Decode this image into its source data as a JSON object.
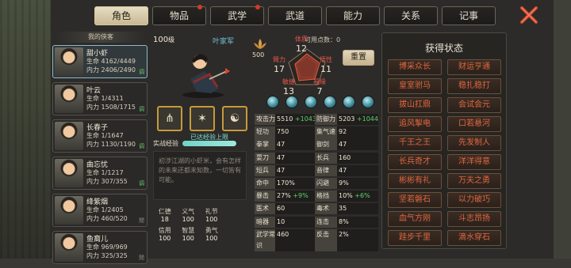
{
  "tabs": [
    {
      "label": "角色",
      "active": true,
      "dot": false
    },
    {
      "label": "物品",
      "active": false,
      "dot": true
    },
    {
      "label": "武学",
      "active": false,
      "dot": true
    },
    {
      "label": "武道",
      "active": false,
      "dot": false
    },
    {
      "label": "能力",
      "active": false,
      "dot": false
    },
    {
      "label": "关系",
      "active": false,
      "dot": false
    },
    {
      "label": "记事",
      "active": false,
      "dot": false
    }
  ],
  "roster": {
    "title": "我的侠客",
    "heroes": [
      {
        "name": "甜小虾",
        "hp": "生命 4162/4449",
        "mp": "内力 2406/2490",
        "tag": "调",
        "selected": true
      },
      {
        "name": "叶云",
        "hp": "生命 1/4311",
        "mp": "内力 1508/1715",
        "tag": "调",
        "selected": false
      },
      {
        "name": "长春子",
        "hp": "生命 1/1647",
        "mp": "内力 1130/1190",
        "tag": "调",
        "selected": false
      },
      {
        "name": "曲忘忧",
        "hp": "生命 1/1217",
        "mp": "内力 307/355",
        "tag": "调",
        "selected": false
      },
      {
        "name": "绛紫烟",
        "hp": "生命 1/2405",
        "mp": "内力 460/520",
        "tag": "閒",
        "selected": false
      },
      {
        "name": "鱼裔儿",
        "hp": "生命 969/969",
        "mp": "内力 325/325",
        "tag": "閒",
        "selected": false
      }
    ]
  },
  "character": {
    "level": "100",
    "level_unit": "级",
    "faction": "叶家军",
    "exp_label": "实战经验",
    "exp_text": "已达经验上限",
    "exp_progress": 1.0,
    "bio": "初涉江湖的小虾米，会有怎样的未来还都未知数，一切皆有可能。",
    "skills": [
      "⋔",
      "✶",
      "☯"
    ],
    "virtues": [
      {
        "label": "仁德",
        "value": "18"
      },
      {
        "label": "义气",
        "value": "100"
      },
      {
        "label": "礼节",
        "value": "100"
      },
      {
        "label": "信用",
        "value": "100"
      },
      {
        "label": "智慧",
        "value": "100"
      },
      {
        "label": "勇气",
        "value": "100"
      }
    ]
  },
  "attributes": {
    "points_label": "可用点数：",
    "points": "0",
    "lotus_value": "500",
    "reset_label": "重置",
    "physique": {
      "label": "体质",
      "value": "12"
    },
    "strength": {
      "label": "臂力",
      "value": "17"
    },
    "spirit": {
      "label": "悟性",
      "value": "11"
    },
    "agility": {
      "label": "敏捷",
      "value": "13"
    },
    "luck": {
      "label": "福缘",
      "value": "7"
    }
  },
  "stats": [
    [
      {
        "k": "攻击力",
        "v": "5510",
        "b": "+1043"
      },
      {
        "k": "防御力",
        "v": "5203",
        "b": "+1044"
      }
    ],
    [
      {
        "k": "轻功",
        "v": "750",
        "b": ""
      },
      {
        "k": "集气速度",
        "v": "92",
        "b": ""
      }
    ],
    [
      {
        "k": "拳掌",
        "v": "47",
        "b": ""
      },
      {
        "k": "御剑",
        "v": "47",
        "b": ""
      }
    ],
    [
      {
        "k": "耍刀",
        "v": "47",
        "b": ""
      },
      {
        "k": "长兵",
        "v": "160",
        "b": ""
      }
    ],
    [
      {
        "k": "短兵",
        "v": "47",
        "b": ""
      },
      {
        "k": "音律",
        "v": "47",
        "b": ""
      }
    ],
    [
      {
        "k": "命中",
        "v": "170%",
        "b": ""
      },
      {
        "k": "闪避",
        "v": "9%",
        "b": ""
      }
    ],
    [
      {
        "k": "暴击",
        "v": "27%",
        "b": "+9%"
      },
      {
        "k": "格挡",
        "v": "10%",
        "b": "+6%"
      }
    ],
    [
      {
        "k": "医术",
        "v": "60",
        "b": ""
      },
      {
        "k": "毒术",
        "v": "35",
        "b": ""
      }
    ],
    [
      {
        "k": "暗器",
        "v": "10",
        "b": ""
      },
      {
        "k": "连击",
        "v": "8%",
        "b": ""
      }
    ],
    [
      {
        "k": "武学常识",
        "v": "460",
        "b": ""
      },
      {
        "k": "反击",
        "v": "2%",
        "b": ""
      }
    ]
  ],
  "status": {
    "title": "获得状态",
    "badges": [
      "博采众长",
      "财运亨通",
      "皇室驸马",
      "稳扎稳打",
      "拔山扛鼎",
      "会试会元",
      "追风掣电",
      "口若悬河",
      "千王之王",
      "先发制人",
      "长兵奇才",
      "洋洋得意",
      "彬彬有礼",
      "万夫之勇",
      "坚若磐石",
      "以力破巧",
      "血气方刚",
      "斗志昂扬",
      "跬步千里",
      "滴水穿石"
    ]
  },
  "colors": {
    "accent_gold": "#c69b3a",
    "status_text": "#e0663f",
    "bonus_green": "#5fd06a",
    "exp_teal": "#7fe0d2"
  }
}
